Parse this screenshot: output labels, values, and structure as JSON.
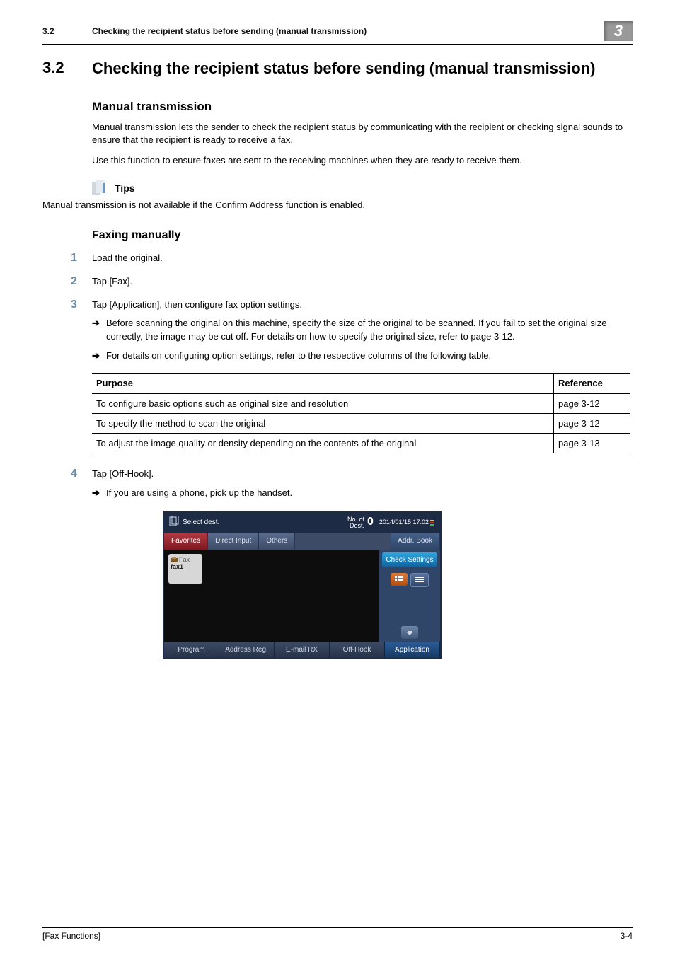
{
  "header": {
    "section": "3.2",
    "title": "Checking the recipient status before sending (manual transmission)",
    "chapter": "3"
  },
  "h1": {
    "num": "3.2",
    "text": "Checking the recipient status before sending (manual transmission)"
  },
  "s_manual": {
    "heading": "Manual transmission",
    "p1": "Manual transmission lets the sender to check the recipient status by communicating with the recipient or checking signal sounds to ensure that the recipient is ready to receive a fax.",
    "p2": "Use this function to ensure faxes are sent to the receiving machines when they are ready to receive them."
  },
  "tips": {
    "label": "Tips",
    "text": "Manual transmission is not available if the Confirm Address function is enabled."
  },
  "s_faxing": {
    "heading": "Faxing manually",
    "step1": "Load the original.",
    "step2": "Tap [Fax].",
    "step3": "Tap [Application], then configure fax option settings.",
    "step3_sub1": "Before scanning the original on this machine, specify the size of the original to be scanned. If you fail to set the original size correctly, the image may be cut off. For details on how to specify the original size, refer to page 3-12.",
    "step3_sub2": "For details on configuring option settings, refer to the respective columns of the following table.",
    "step4": "Tap [Off-Hook].",
    "step4_sub1": "If you are using a phone, pick up the handset."
  },
  "table": {
    "col1": "Purpose",
    "col2": "Reference",
    "rows": [
      {
        "purpose": "To configure basic options such as original size and resolution",
        "ref": "page 3-12"
      },
      {
        "purpose": "To specify the method to scan the original",
        "ref": "page 3-12"
      },
      {
        "purpose": "To adjust the image quality or density depending on the contents of the original",
        "ref": "page 3-13"
      }
    ]
  },
  "device": {
    "select_dest": "Select dest.",
    "no_of_dest_label": "No. of\nDest.",
    "no_of_dest_value": "0",
    "datetime": "2014/01/15 17:02",
    "tabs": {
      "favorites": "Favorites",
      "direct_input": "Direct Input",
      "others": "Others",
      "addr_book": "Addr. Book"
    },
    "check_settings": "Check Settings",
    "fax_card": {
      "type": "Fax",
      "name": "fax1"
    },
    "bottom": {
      "program": "Program",
      "address_reg": "Address Reg.",
      "email_rx": "E-mail RX",
      "off_hook": "Off-Hook",
      "application": "Application"
    }
  },
  "footer": {
    "left": "[Fax Functions]",
    "right": "3-4"
  }
}
